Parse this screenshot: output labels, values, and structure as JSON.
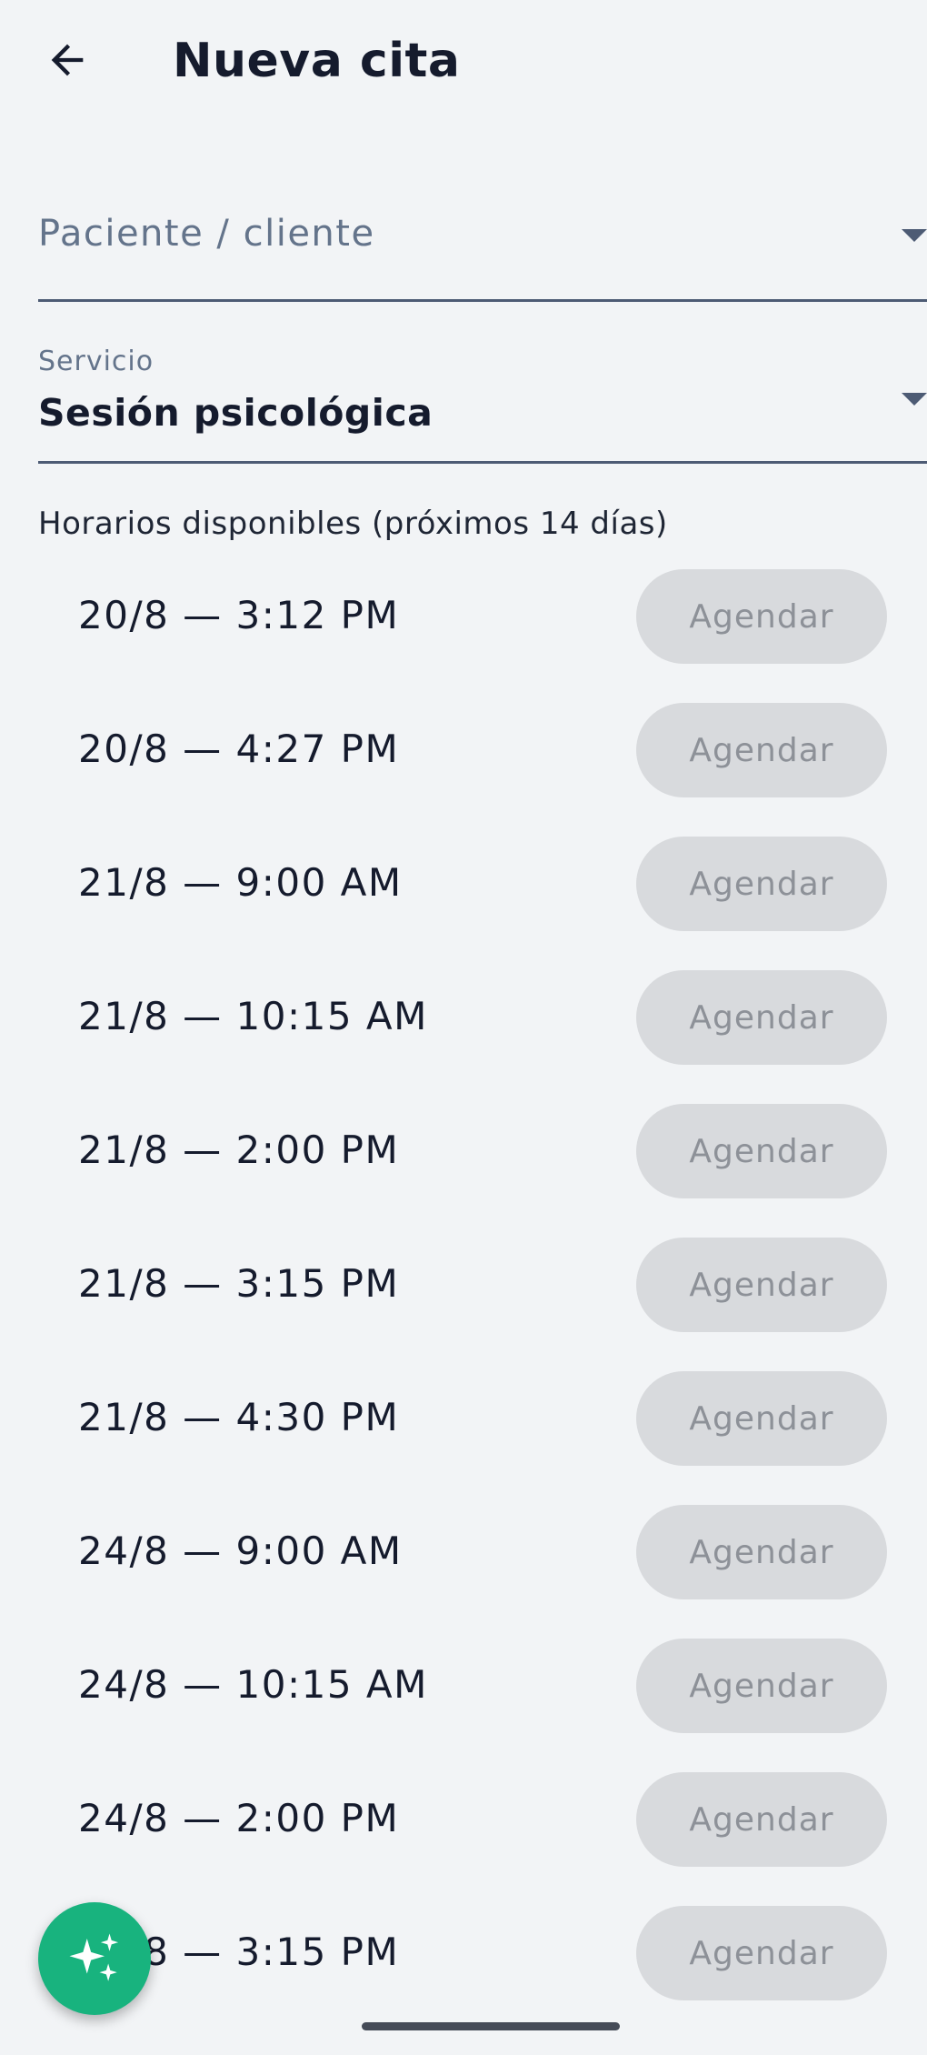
{
  "header": {
    "title": "Nueva cita",
    "back_icon": "arrow-back-icon"
  },
  "patient_field": {
    "placeholder": "Paciente / cliente",
    "icon": "dropdown-arrow-icon"
  },
  "service_field": {
    "label": "Servicio",
    "value": "Sesión psicológica",
    "icon": "dropdown-arrow-icon"
  },
  "slots_section": {
    "heading": "Horarios disponibles (próximos 14 días)"
  },
  "slots": [
    {
      "label": "20/8 — 3:12 PM",
      "button": "Agendar"
    },
    {
      "label": "20/8 — 4:27 PM",
      "button": "Agendar"
    },
    {
      "label": "21/8 — 9:00 AM",
      "button": "Agendar"
    },
    {
      "label": "21/8 — 10:15 AM",
      "button": "Agendar"
    },
    {
      "label": "21/8 — 2:00 PM",
      "button": "Agendar"
    },
    {
      "label": "21/8 — 3:15 PM",
      "button": "Agendar"
    },
    {
      "label": "21/8 — 4:30 PM",
      "button": "Agendar"
    },
    {
      "label": "24/8 — 9:00 AM",
      "button": "Agendar"
    },
    {
      "label": "24/8 — 10:15 AM",
      "button": "Agendar"
    },
    {
      "label": "24/8 — 2:00 PM",
      "button": "Agendar"
    },
    {
      "label": "24/8 — 3:15 PM",
      "button": "Agendar"
    }
  ],
  "fab": {
    "icon": "sparkles-icon"
  },
  "colors": {
    "background": "#f2f4f6",
    "text": "#151b2d",
    "muted": "#64748b",
    "button_disabled_bg": "#d8dadd",
    "button_disabled_text": "#8d9198",
    "fab": "#18b37e"
  }
}
